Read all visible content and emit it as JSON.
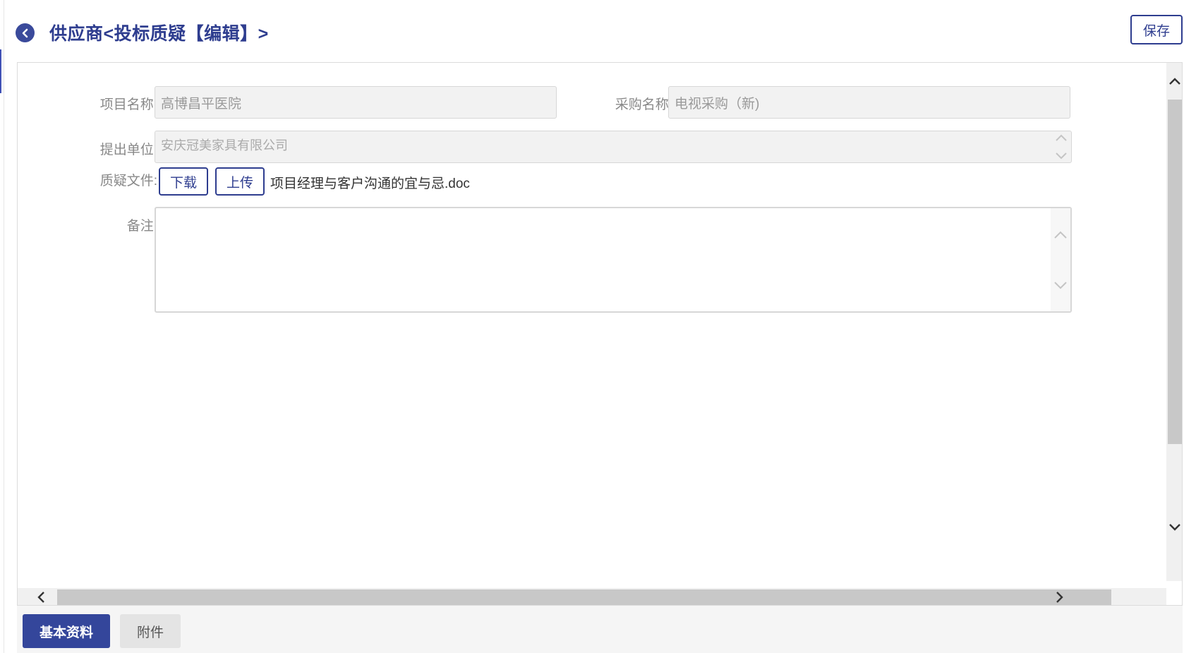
{
  "header": {
    "title": "供应商<投标质疑【编辑】>",
    "save_label": "保存",
    "back_icon": "chevron-left-icon"
  },
  "form": {
    "project_name": {
      "label": "项目名称:",
      "value": "高博昌平医院"
    },
    "purchase_name": {
      "label": "采购名称:",
      "value": "电视采购（新)"
    },
    "submitting_unit": {
      "label": "提出单位:",
      "value": "安庆冠美家具有限公司"
    },
    "challenge_file": {
      "label": "质疑文件:",
      "download_label": "下载",
      "upload_label": "上传",
      "file_name": "项目经理与客户沟通的宜与忌.doc"
    },
    "remarks": {
      "label": "备注:",
      "value": ""
    }
  },
  "tabs": [
    {
      "label": "基本资料",
      "active": true
    },
    {
      "label": "附件",
      "active": false
    }
  ],
  "colors": {
    "accent": "#2e3d8f",
    "tab_active": "#34469b"
  }
}
